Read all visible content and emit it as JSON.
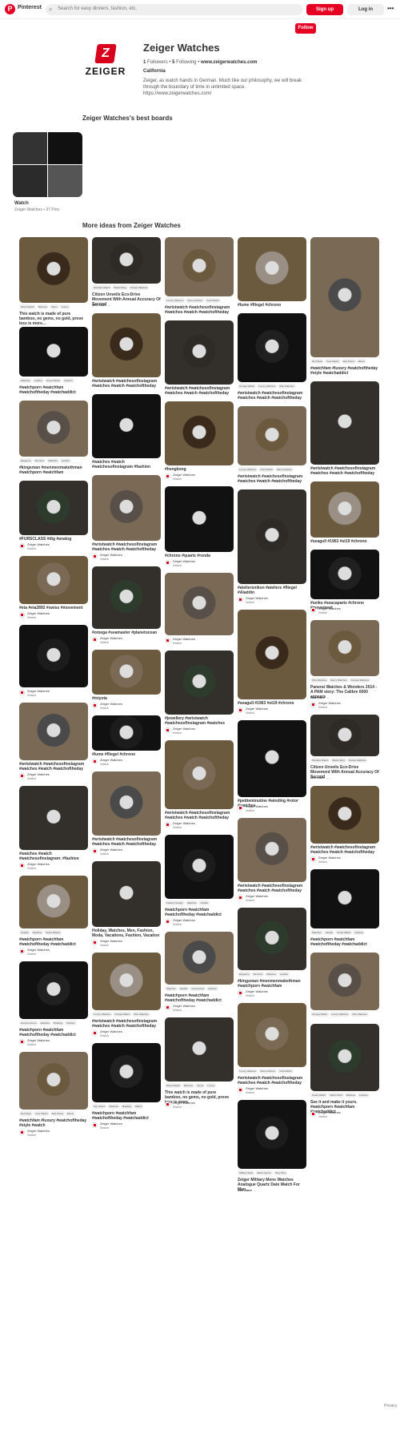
{
  "header": {
    "logo_glyph": "P",
    "brand": "Pinterest",
    "search_icon": "search-icon",
    "search_placeholder": "Search for easy dinners, fashion, etc.",
    "signup": "Sign up",
    "login": "Log in",
    "more": "•••"
  },
  "profile": {
    "follow": "Follow",
    "logo_mark": "Z",
    "logo_word": "ZEIGER",
    "name": "Zeiger Watches",
    "followers_count": "1",
    "followers_label": "Followers",
    "dot1": "•",
    "following_count": "5",
    "following_label": "Following",
    "dot2": "•",
    "website": "www.zeigerwatches.com",
    "location": "California",
    "about": "Zeiger, as watch hands in German. Much like our philosophy, we will break through the boundary of time in unlimited space. https://www.zeigerwatches.com/"
  },
  "boards_heading": "Zeiger Watches's best boards",
  "board": {
    "name": "Watch",
    "meta": "Zeiger Watches • 37 Pins"
  },
  "ideas_heading": "More ideas from Zeiger Watches",
  "colors": {
    "brand_red": "#e60023",
    "zeiger_red": "#d7001d"
  },
  "pins": [
    {
      "tags": [
        "Wood Watch",
        "Bamboo",
        "Mens",
        "Luxury"
      ],
      "title": "This watch is made of pure bamboo, no gems, no gold, prove less is more...",
      "seemore": "",
      "by": "",
      "board": ""
    },
    {
      "tags": [
        "Watches",
        "Leather",
        "Smart Watch",
        "Fashion"
      ],
      "title": "#watchporn #watchfam #watchoftheday #watchaddict",
      "seemore": "",
      "by": "",
      "board": ""
    },
    {
      "tags": [
        "Elegance",
        "Womens",
        "Watches",
        "Leather"
      ],
      "title": "#kingsman #menmenmakethman #watchporn #watchfam",
      "seemore": "",
      "by": "",
      "board": ""
    },
    {
      "tags": [],
      "title": "#FURSCLASS #dig #analog",
      "seemore": "",
      "by": "Zeiger Watches",
      "board": "Watch"
    },
    {
      "tags": [],
      "title": "#eta #eta2892 #swiss #movement",
      "seemore": "",
      "by": "Zeiger Watches",
      "board": "Watch"
    },
    {
      "tags": [],
      "title": "",
      "seemore": "",
      "by": "Zeiger Watches",
      "board": "Watch"
    },
    {
      "tags": [],
      "title": "#wristwatch #watchesofinstagram #watches #watch #watchoftheday",
      "seemore": "",
      "by": "Zeiger Watches",
      "board": "Watch"
    },
    {
      "tags": [],
      "title": "#watches #watch #watchesofinstagram: #fashion",
      "seemore": "",
      "by": "Zeiger Watches",
      "board": "Watch"
    },
    {
      "tags": [
        "LikeMe",
        "Watches",
        "Swiss Military"
      ],
      "title": "#watchporn #watchfam #watchoftheday #watchaddict",
      "seemore": "",
      "by": "Zeiger Watches",
      "board": "Watch"
    },
    {
      "tags": [
        "Harvest Green",
        "Watches",
        "Braiding",
        "Fashion"
      ],
      "title": "#watchporn #watchfam #watchoftheday #watchaddict",
      "seemore": "",
      "by": "Zeiger Watches",
      "board": "Watch"
    },
    {
      "tags": [
        "Red Style",
        "Cute Watch",
        "Red Wood",
        "Wood"
      ],
      "title": "#watchfam #luxury #watchoftheday #style #watch",
      "seemore": "",
      "by": "Zeiger Watches",
      "board": "Watch"
    },
    {
      "tags": [
        "Pendant Watch",
        "Watch Ring",
        "Pocket Watches"
      ],
      "title": "Citizen Unveils Eco-Drive Movement With Annual Accuracy Of Second",
      "seemore": "See more →",
      "by": "",
      "board": ""
    },
    {
      "tags": [],
      "title": "#wristwatch #watchesofinstagram #watches #watch #watchoftheday",
      "seemore": "",
      "by": "",
      "board": ""
    },
    {
      "tags": [],
      "title": "#watches #watch #watchesofinstagram #fashion",
      "seemore": "",
      "by": "",
      "board": ""
    },
    {
      "tags": [],
      "title": "#wristwatch #watchesofinstagram #watches #watch #watchoftheday",
      "seemore": "",
      "by": "Zeiger Watches",
      "board": "Watch"
    },
    {
      "tags": [],
      "title": "#omega #seamaster #planetocean",
      "seemore": "",
      "by": "Zeiger Watches",
      "board": "Watch"
    },
    {
      "tags": [],
      "title": "#miyota",
      "seemore": "",
      "by": "Zeiger Watches",
      "board": "Watch"
    },
    {
      "tags": [],
      "title": "#lume #fliegel #chrono",
      "seemore": "",
      "by": "Zeiger Watches",
      "board": "Watch"
    },
    {
      "tags": [],
      "title": "#wristwatch #watchesofinstagram #watches #watch #watchoftheday",
      "seemore": "",
      "by": "Zeiger Watches",
      "board": "Watch"
    },
    {
      "tags": [],
      "title": "Holiday, Watches, Men, Fashion, Moda, Vacations, Fashion, Vacation",
      "seemore": "",
      "by": "Zeiger Watches",
      "board": "Watch"
    },
    {
      "tags": [
        "Luxury Watches",
        "Omega Watch",
        "Man Watches"
      ],
      "title": "#wristwatch #watchesofinstagram #watches #watch #watchoftheday",
      "seemore": "",
      "by": "Zeiger Watches",
      "board": "Watch"
    },
    {
      "tags": [
        "Spy Watch",
        "Watches",
        "Braiding",
        "Watch"
      ],
      "title": "#watchporn #watchfam #watchoftheday #watchaddict",
      "seemore": "",
      "by": "Zeiger Watches",
      "board": "Watch"
    },
    {
      "tags": [
        "Luxury Watches",
        "Mens Fashion",
        "Gold Watch"
      ],
      "title": "#wristwatch #watchesofinstagram #watches #watch #watchoftheday",
      "seemore": "",
      "by": "",
      "board": ""
    },
    {
      "tags": [],
      "title": "#wristwatch #watchesofinstagram #watches #watch #watchoftheday",
      "seemore": "",
      "by": "",
      "board": ""
    },
    {
      "tags": [],
      "title": "#hengkong",
      "seemore": "",
      "by": "Zeiger Watches",
      "board": "Watch"
    },
    {
      "tags": [],
      "title": "#chrono #quartz #ronda",
      "seemore": "",
      "by": "Zeiger Watches",
      "board": "Watch"
    },
    {
      "tags": [],
      "title": "",
      "seemore": "",
      "by": "Zeiger Watches",
      "board": "Watch"
    },
    {
      "tags": [],
      "title": "#jewellery #wristwatch #watchesofinstagram #watches",
      "seemore": "",
      "by": "Zeiger Watches",
      "board": "Watch"
    },
    {
      "tags": [],
      "title": "#wristwatch #watchesofinstagram #watches #watch #watchoftheday",
      "seemore": "",
      "by": "Zeiger Watches",
      "board": "Watch"
    },
    {
      "tags": [
        "Fashion Design",
        "Watches",
        "LikeMe"
      ],
      "title": "#watchporn #watchfam #watchoftheday #watchaddict",
      "seemore": "",
      "by": "Zeiger Watches",
      "board": "Watch"
    },
    {
      "tags": [
        "Watches",
        "LikeMe",
        "Accessories",
        "Fashion"
      ],
      "title": "#watchporn #watchfam #watchoftheday #watchaddict",
      "seemore": "",
      "by": "Zeiger Watches",
      "board": "Watch"
    },
    {
      "tags": [
        "Wood Watch",
        "Bamboo",
        "Gems",
        "Luxury"
      ],
      "title": "This watch is made of pure bamboo, no gems, no gold, prove less is more.",
      "seemore": "",
      "by": "Zeiger Watches",
      "board": "Watch"
    },
    {
      "tags": [],
      "title": "#lume #fliegel #chrono",
      "seemore": "",
      "by": "",
      "board": ""
    },
    {
      "tags": [
        "Omega Watch",
        "Luxury Watches",
        "Man Watches"
      ],
      "title": "#wristwatch #watchesofinstagram #watches #watch #watchoftheday",
      "seemore": "",
      "by": "",
      "board": ""
    },
    {
      "tags": [
        "Luxury Watches",
        "Gold Watch",
        "Mens Fashion"
      ],
      "title": "#wristwatch #watchesofinstagram #watches #watch #watchoftheday",
      "seemore": "",
      "by": "",
      "board": ""
    },
    {
      "tags": [],
      "title": "#ateliersnikon #ateliers #fliegel #Aladdin",
      "seemore": "",
      "by": "Zeiger Watches",
      "board": "Watch"
    },
    {
      "tags": [],
      "title": "#seagull #1963 #st19 #chrono",
      "seemore": "",
      "by": "Zeiger Watches",
      "board": "Watch"
    },
    {
      "tags": [],
      "title": "#petiteminutine #winding #rotor #watches",
      "seemore": "",
      "by": "Zeiger Watches",
      "board": "Watch"
    },
    {
      "tags": [],
      "title": "#wristwatch #watchesofinstagram #watches #watch #watchoftheday",
      "seemore": "",
      "by": "Zeiger Watches",
      "board": "Watch"
    },
    {
      "tags": [
        "Elegance",
        "Womens",
        "Watches",
        "Leather"
      ],
      "title": "#kingsman #menmenmakethman #watchporn #watchfam",
      "seemore": "",
      "by": "Zeiger Watches",
      "board": "Watch"
    },
    {
      "tags": [
        "Luxury Watches",
        "Mens Fashion",
        "Gold Watch"
      ],
      "title": "#wristwatch #watchesofinstagram #watches #watch #watchoftheday",
      "seemore": "",
      "by": "Zeiger Watches",
      "board": "Watch"
    },
    {
      "tags": [
        "Military Wear",
        "Black Nylons",
        "Navy Blue"
      ],
      "title": "Zeiger Military Mens Watches Analogue Quartz Date Watch For Man",
      "seemore": "See more →",
      "by": "",
      "board": ""
    },
    {
      "tags": [
        "Red Style",
        "Cute Watch",
        "Red Wood",
        "Wood"
      ],
      "title": "#watchfam #luxury #watchoftheday #style #watchaddict",
      "seemore": "",
      "by": "",
      "board": ""
    },
    {
      "tags": [],
      "title": "#wristwatch #watchesofinstagram #watches #watch #watchoftheday",
      "seemore": "",
      "by": "",
      "board": ""
    },
    {
      "tags": [],
      "title": "#seagull #1963 #st19 #chrono",
      "seemore": "",
      "by": "",
      "board": ""
    },
    {
      "tags": [],
      "title": "#seiko #seacaparte #chrono #movement",
      "seemore": "",
      "by": "Zeiger Watches",
      "board": "Watch"
    },
    {
      "tags": [
        "Pink Watches",
        "Men's Watches",
        "Panerai Watches"
      ],
      "title": "Panerai Watches & Wonders 2014 - A PAM story: The Calibre 6000 appears",
      "seemore": "See more →",
      "by": "Zeiger Watches",
      "board": "Watch"
    },
    {
      "tags": [
        "Pendant Watch",
        "Watch Ring",
        "Pocket Watches"
      ],
      "title": "Citizen Unveils Eco-Drive Movement With Annual Accuracy Of Second",
      "seemore": "See more →",
      "by": "",
      "board": ""
    },
    {
      "tags": [],
      "title": "#wristwatch #watchesofinstagram #watches #watch #watchoftheday",
      "seemore": "",
      "by": "Zeiger Watches",
      "board": "Watch"
    },
    {
      "tags": [
        "Watches",
        "LikeMe",
        "Smart Watch",
        "Fashion"
      ],
      "title": "#watchporn #watchfam #watchoftheday #watchaddict",
      "seemore": "",
      "by": "",
      "board": ""
    },
    {
      "tags": [
        "Omega Watch",
        "Luxury Watches",
        "Man Watches"
      ],
      "title": "",
      "seemore": "",
      "by": "",
      "board": ""
    },
    {
      "tags": [
        "Smart Watch",
        "Watch Stuff",
        "Watches",
        "Fashion"
      ],
      "title": "See it and make it yours. #watchporn #watchfam #watchaddict",
      "seemore": "",
      "by": "Zeiger Watches",
      "board": "Watch"
    }
  ],
  "footer": {
    "privacy": "Privacy"
  }
}
